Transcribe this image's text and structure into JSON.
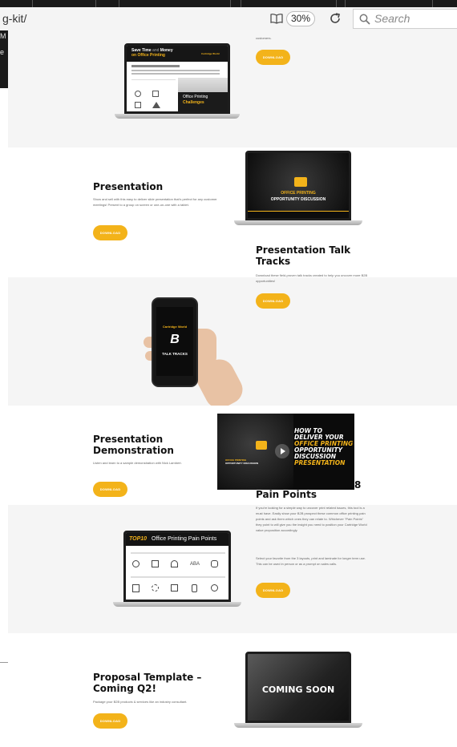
{
  "browser": {
    "url_text": "g-kit/",
    "zoom": "30%",
    "search_placeholder": "Search"
  },
  "left_overlay": {
    "line1": "M",
    "line2": "e"
  },
  "top_section": {
    "body_tail": "customers.",
    "button": "DOWNLOAD",
    "screen": {
      "headline_white": "Save Time",
      "headline_and": "and",
      "headline_money": "Money",
      "headline_line2": "on Office Printing",
      "brand": "Cartridge World",
      "subtitle": "Office Printing",
      "subtitle_accent": "Challenges"
    }
  },
  "presentation": {
    "title": "Presentation",
    "body": "Show and sell with this easy to deliver slide presentation that's perfect for any customer meetings! Present to a group on screen or one-on-one with a tablet.",
    "button": "DOWNLOAD",
    "screen_title": "OFFICE PRINTING",
    "screen_subtitle": "OPPORTUNITY DISCUSSION"
  },
  "talk_tracks": {
    "title": "Presentation Talk Tracks",
    "body": "Download these field-proven talk tracks created to help you uncover more B2B opportunities!",
    "button": "DOWNLOAD",
    "phone_brand": "Cartridge World",
    "phone_label": "TALK TRACKS"
  },
  "demonstration": {
    "title": "Presentation Demonstration",
    "body": "Listen and learn to a sample demonstration with Nick Lambert.",
    "button": "DOWNLOAD",
    "video_line1": "HOW TO",
    "video_line2": "DELIVER YOUR",
    "video_line3": "OFFICE PRINTING",
    "video_line4": "OPPORTUNITY",
    "video_line5": "DISCUSSION",
    "video_line6": "PRESENTATION",
    "video_small1": "OFFICE PRINTING",
    "video_small2": "OPPORTUNITY DISCUSSION"
  },
  "pain_points": {
    "title": "Pain Points",
    "title_fragment": "8",
    "body1": "If you're looking for a simple way to uncover print related issues, this tool is a must have. Easily show your B2B prospect these common office printing pain points and ask them which ones they can relate to. Whichever \"Pain Points\" they point to will give you the insight you need to position your Cartridge World value proposition accordingly.",
    "body2": "Select your favorite from the 3 layouts, print and laminate for longer term use. This can be used in person or as a prompt on sales calls.",
    "button": "DOWNLOAD",
    "screen_top": "TOP10",
    "screen_title": "Office Printing Pain Points"
  },
  "proposal": {
    "title": "Proposal Template – Coming Q2!",
    "body": "Package your B2B products & services like an industry consultant.",
    "button": "DOWNLOAD",
    "screen_label": "COMING SOON"
  },
  "colors": {
    "accent": "#f3b31a",
    "band": "#f5f5f5",
    "dark": "#111111"
  }
}
